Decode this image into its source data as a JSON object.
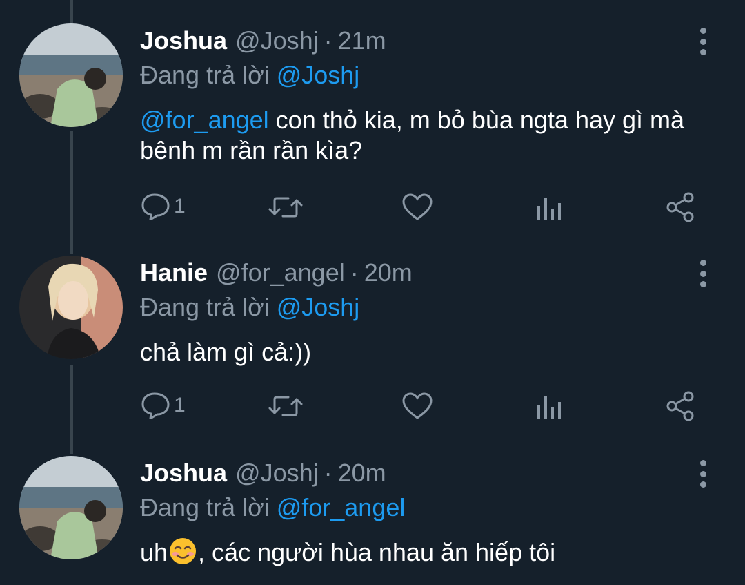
{
  "reply_prefix": "Đang trả lời",
  "tweets": [
    {
      "name": "Joshua",
      "handle": "@Joshj",
      "separator": "·",
      "time": "21m",
      "reply_to": "@Joshj",
      "mention": "@for_angel",
      "text": " con thỏ kia, m bỏ bùa ngta hay gì mà bênh m rần rần kìa?",
      "reply_count": "1"
    },
    {
      "name": "Hanie",
      "handle": "@for_angel",
      "separator": "·",
      "time": "20m",
      "reply_to": "@Joshj",
      "text": "chả làm gì cả:))",
      "reply_count": "1"
    },
    {
      "name": "Joshua",
      "handle": "@Joshj",
      "separator": "·",
      "time": "20m",
      "reply_to": "@for_angel",
      "text_before_emoji": "uh",
      "emoji": "smiling-face-emoji",
      "text_after_emoji": ", các người hùa nhau ăn hiếp tôi"
    }
  ],
  "colors": {
    "background": "#15202b",
    "secondary_text": "#8b98a5",
    "link": "#1d9bf0",
    "thread_line": "#38444d"
  }
}
